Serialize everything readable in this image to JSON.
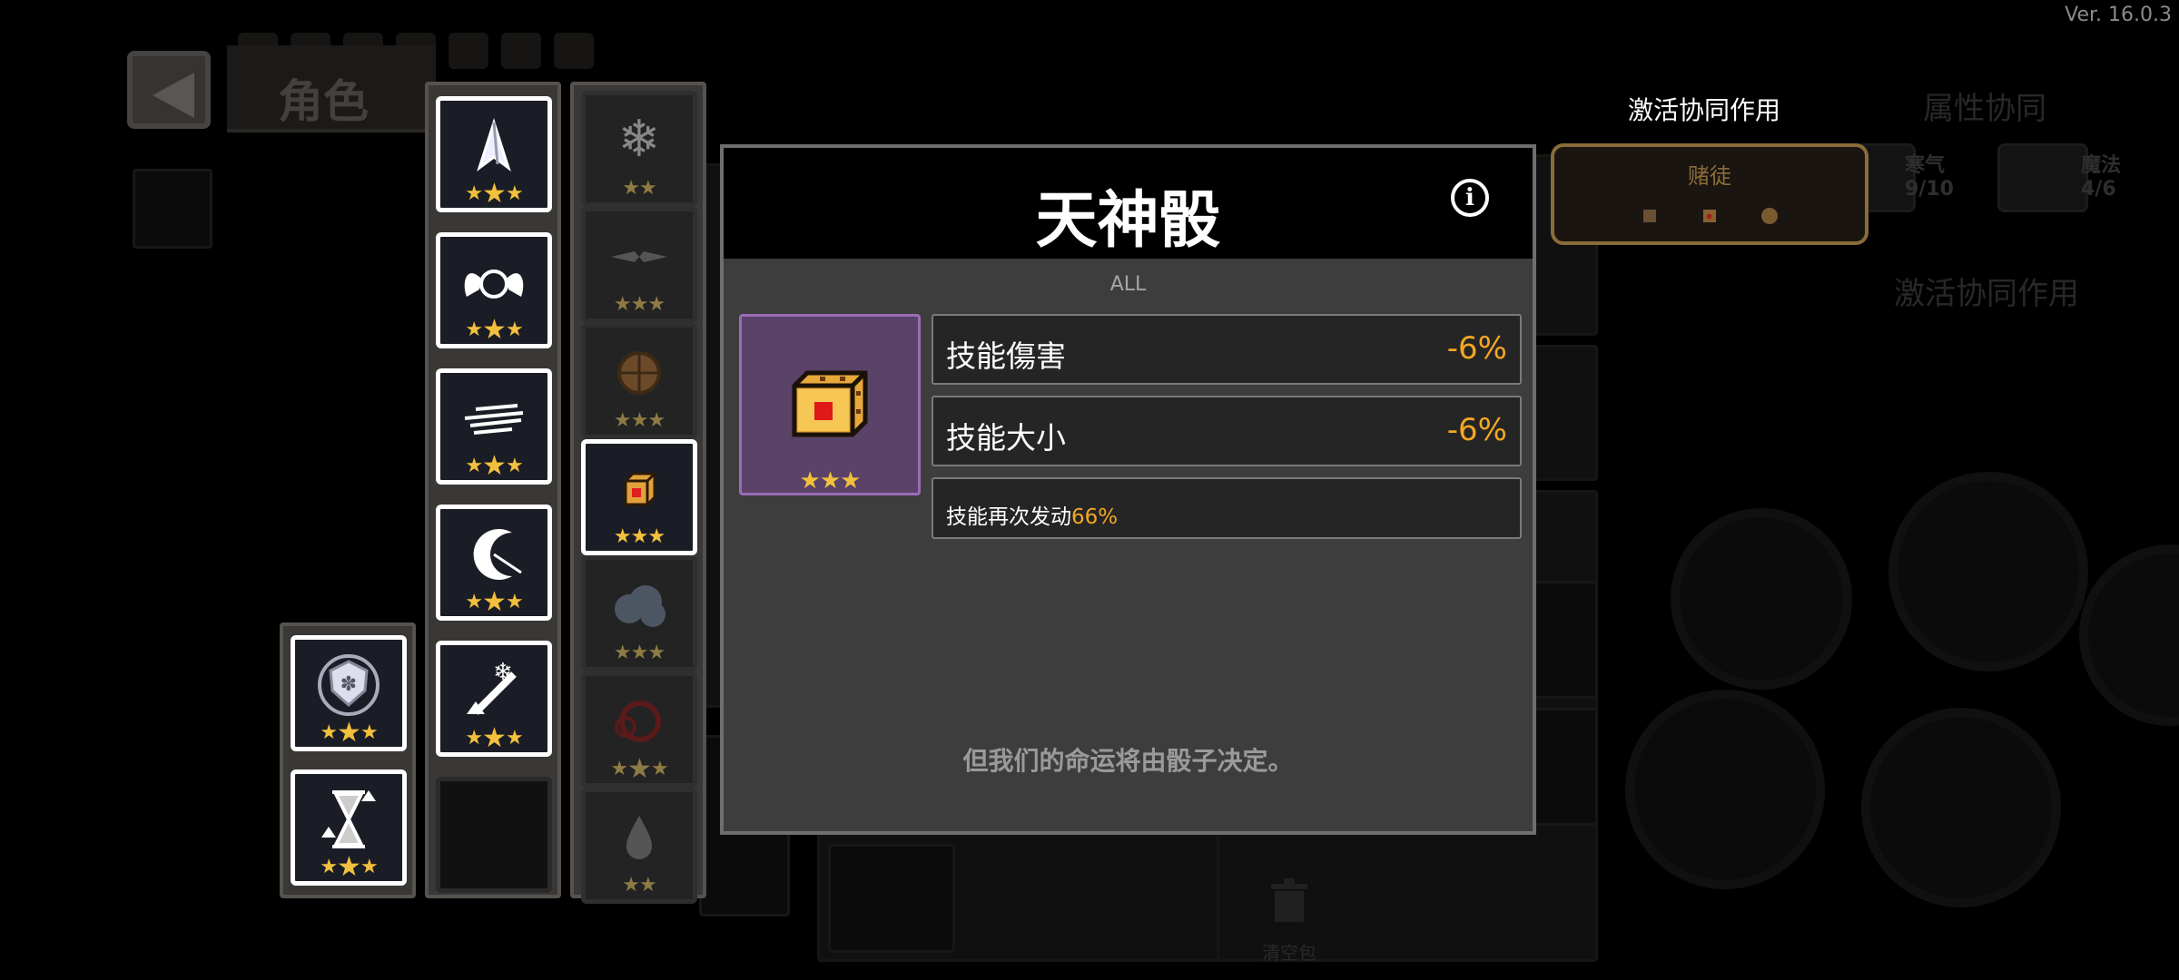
{
  "version": "Ver. 16.0.3",
  "header": {
    "role_tab": "角色"
  },
  "popup": {
    "title": "天神骰",
    "category": "ALL",
    "item_stars": 3,
    "stats": [
      {
        "name": "技能傷害",
        "value": "-6%"
      },
      {
        "name": "技能大小",
        "value": "-6%"
      }
    ],
    "effect": {
      "text": "技能再次发动",
      "value": "66%"
    },
    "flavor": "但我们的命运将由骰子决定。"
  },
  "synergy": {
    "title": "激活协同作用",
    "box_label": "赌徒"
  },
  "background": {
    "attr_synergy": "属性协同",
    "activate_synergy": "激活协同作用",
    "syn1_name": "寒气",
    "syn1_count": "9/10",
    "syn2_name": "魔法",
    "syn2_count": "4/6",
    "clear_bag": "清空包"
  },
  "inventory": {
    "col1": [
      {
        "icon": "spirit-shield-icon",
        "stars": "★★★"
      },
      {
        "icon": "hourglass-upgrade-icon",
        "stars": "★★★"
      }
    ],
    "col2": [
      {
        "icon": "crystal-claw-icon",
        "stars": "★★★"
      },
      {
        "icon": "winged-orb-icon",
        "stars": "★★★"
      },
      {
        "icon": "wind-slash-icon",
        "stars": "★★★"
      },
      {
        "icon": "crescent-blade-icon",
        "stars": "★★★"
      },
      {
        "icon": "frost-sword-icon",
        "stars": "★★★"
      }
    ],
    "col3": [
      {
        "icon": "snowflake-icon",
        "stars": "★★"
      },
      {
        "icon": "dark-wings-icon",
        "stars": "★★★"
      },
      {
        "icon": "wooden-shield-icon",
        "stars": "★★★"
      },
      {
        "icon": "dice-icon",
        "stars": "★★★"
      },
      {
        "icon": "frost-cloud-icon",
        "stars": "★★★"
      },
      {
        "icon": "red-ring-icon",
        "stars": "★★★"
      },
      {
        "icon": "water-drop-icon",
        "stars": "★★"
      }
    ]
  },
  "colors": {
    "accent": "#f5a623",
    "item_bg": "#5a4268",
    "synergy_border": "#8a6c3a"
  }
}
